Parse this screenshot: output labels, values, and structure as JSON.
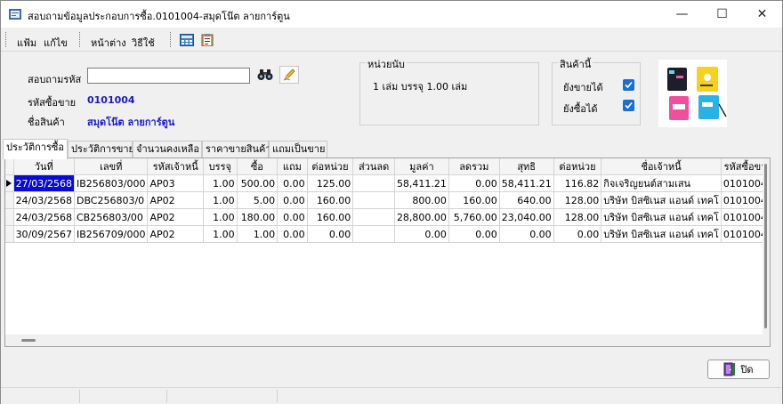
{
  "window": {
    "title": "สอบถามข้อมูลประกอบการซื้อ.0101004-สมุดโน๊ต ลายการ์ตูน",
    "minimize": "—",
    "maximize": "☐",
    "close": "✕"
  },
  "menu": {
    "items": [
      "แฟ้ม",
      "แก้ไข",
      "หน้าต่าง",
      "วิธีใช้"
    ]
  },
  "form": {
    "search_label": "สอบถามรหัส",
    "search_value": "",
    "seller_code_label": "รหัสซื้อขาย",
    "seller_code_value": "0101004",
    "product_name_label": "ชื่อสินค้า",
    "product_name_value": "สมุดโน๊ต ลายการ์ตูน"
  },
  "unit_box": {
    "title": "หน่วยนับ",
    "text": "1 เล่ม บรรจุ 1.00 เล่ม"
  },
  "product_box": {
    "title": "สินค้านี้",
    "can_sell_label": "ยังขายได้",
    "can_sell_checked": true,
    "can_buy_label": "ยังซื้อได้",
    "can_buy_checked": true
  },
  "tabs": [
    {
      "label": "ประวัติการซื้อ",
      "active": true
    },
    {
      "label": "ประวัติการขาย",
      "active": false
    },
    {
      "label": "จำนวนคงเหลือ",
      "active": false
    },
    {
      "label": "ราคาขายสินค้า",
      "active": false
    },
    {
      "label": "แถมเป็นขาย",
      "active": false
    }
  ],
  "table": {
    "columns": [
      "วันที่",
      "เลขที่",
      "รหัสเจ้าหนี้",
      "บรรจุ",
      "ซื้อ",
      "แถม",
      "ต่อหน่วย",
      "ส่วนลด",
      "มูลค่า",
      "ลดรวม",
      "สุทธิ",
      "ต่อหน่วย",
      "ชื่อเจ้าหนี้",
      "รหัสซื้อขา"
    ],
    "rows": [
      [
        "27/03/2568",
        "IB256803/000",
        "AP03",
        "1.00",
        "500.00",
        "0.00",
        "125.00",
        "",
        "58,411.21",
        "0.00",
        "58,411.21",
        "116.82",
        "กิจเจริญยนต์สามเสน",
        "0101004"
      ],
      [
        "24/03/2568",
        "DBC256803/0",
        "AP02",
        "1.00",
        "5.00",
        "0.00",
        "160.00",
        "",
        "800.00",
        "160.00",
        "640.00",
        "128.00",
        "บริษัท บิสซิเนส  แอนด์ เทคโ",
        "0101004"
      ],
      [
        "24/03/2568",
        "CB256803/00",
        "AP02",
        "1.00",
        "180.00",
        "0.00",
        "160.00",
        "",
        "28,800.00",
        "5,760.00",
        "23,040.00",
        "128.00",
        "บริษัท บิสซิเนส  แอนด์ เทคโ",
        "0101004"
      ],
      [
        "30/09/2567",
        "IB256709/000",
        "AP02",
        "1.00",
        "1.00",
        "0.00",
        "0.00",
        "",
        "0.00",
        "0.00",
        "0.00",
        "0.00",
        "บริษัท บิสซิเนส  แอนด์ เทคโ",
        "0101004"
      ]
    ]
  },
  "buttons": {
    "close_label": "ปิด"
  },
  "colors": {
    "accent": "#1a1acc",
    "selection": "#0a0ad8",
    "checkbox": "#1a6fd6"
  }
}
